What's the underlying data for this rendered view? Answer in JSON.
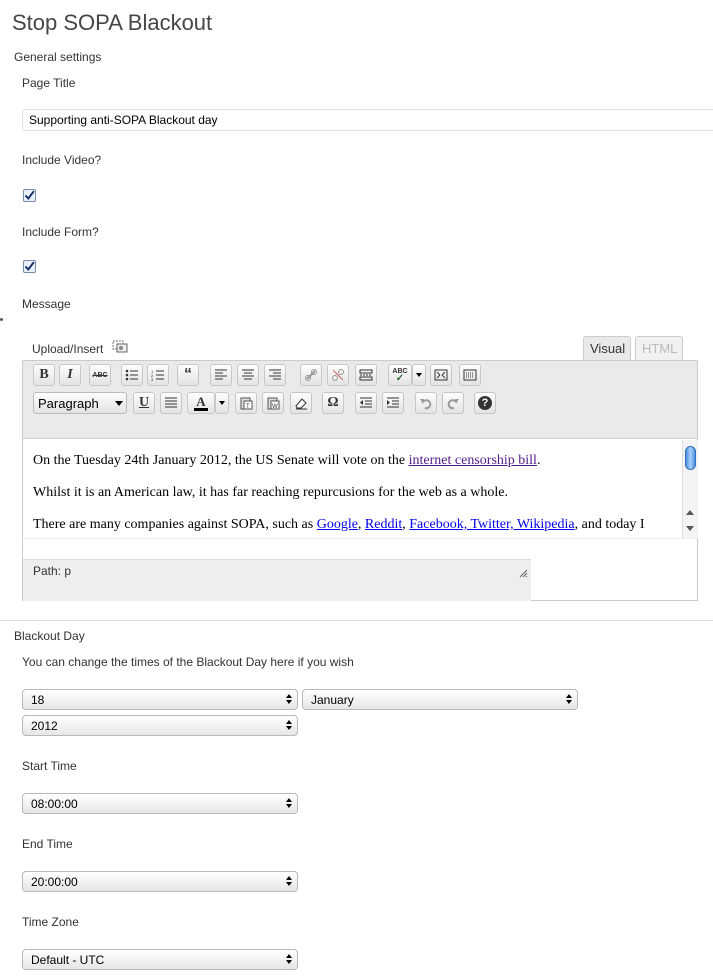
{
  "page": {
    "title": "Stop SOPA Blackout"
  },
  "general": {
    "heading": "General settings",
    "page_title_label": "Page Title",
    "page_title_value": "Supporting anti-SOPA Blackout day",
    "include_video_label": "Include Video?",
    "include_video_checked": true,
    "include_form_label": "Include Form?",
    "include_form_checked": true,
    "message_label": "Message"
  },
  "editor": {
    "upload_insert": "Upload/Insert",
    "tabs": [
      {
        "label": "Visual",
        "active": true
      },
      {
        "label": "HTML",
        "active": false
      }
    ],
    "toolbar": {
      "bold": "B",
      "italic": "I",
      "strike": "ABC",
      "underline": "U",
      "text_color": "A",
      "special_char": "Ω",
      "help": "?",
      "spellcheck": "ABC",
      "format_value": "Paragraph"
    },
    "content": {
      "p1_before": "On the Tuesday 24th January 2012, the US Senate will vote on the ",
      "p1_link": "internet censorship bill",
      "p1_after": ".",
      "p2": "Whilst it is an American law, it has far reaching repurcusions for the web as a whole.",
      "p3_before": "There are many companies against SOPA, such as ",
      "p3_link1": "Google",
      "p3_sep1": ", ",
      "p3_link2": "Reddit",
      "p3_sep2": ", ",
      "p3_link3": "Facebook, Twitter, Wikipedia",
      "p3_after": ", and today I"
    },
    "path": "Path: p"
  },
  "blackout": {
    "heading": "Blackout Day",
    "description": "You can change the times of the Blackout Day here if you wish",
    "day_value": "18",
    "month_value": "January",
    "year_value": "2012",
    "start_label": "Start Time",
    "start_value": "08:00:00",
    "end_label": "End Time",
    "end_value": "20:00:00",
    "timezone_label": "Time Zone",
    "timezone_value": "Default - UTC"
  }
}
